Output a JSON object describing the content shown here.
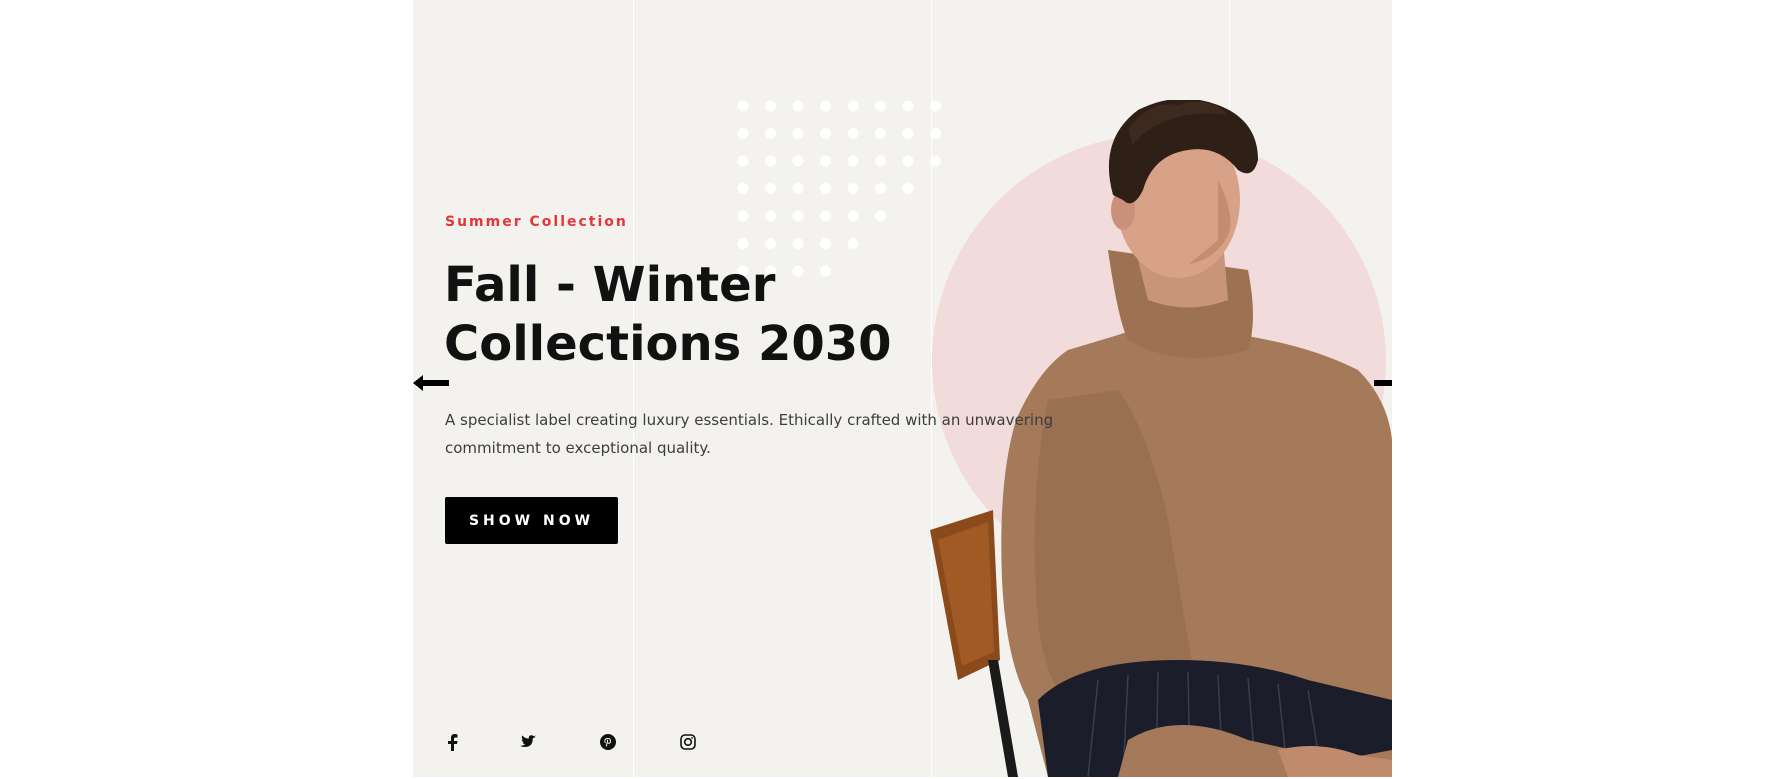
{
  "hero": {
    "subtitle": "Summer Collection",
    "title": "Fall - Winter Collections 2030",
    "description": "A specialist label creating luxury essentials. Ethically crafted with an unwavering commitment to exceptional quality.",
    "button_label": "SHOW NOW"
  },
  "navigation": {
    "prev_icon": "arrow-left-icon",
    "next_icon": "arrow-right-icon"
  },
  "socials": [
    {
      "icon": "facebook-icon"
    },
    {
      "icon": "twitter-icon"
    },
    {
      "icon": "pinterest-icon"
    },
    {
      "icon": "instagram-icon"
    }
  ],
  "colors": {
    "accent": "#e53637",
    "background": "#f3f2ee",
    "circle": "#f2dcdb",
    "button": "#000000",
    "sweater": "#a47a5a"
  }
}
